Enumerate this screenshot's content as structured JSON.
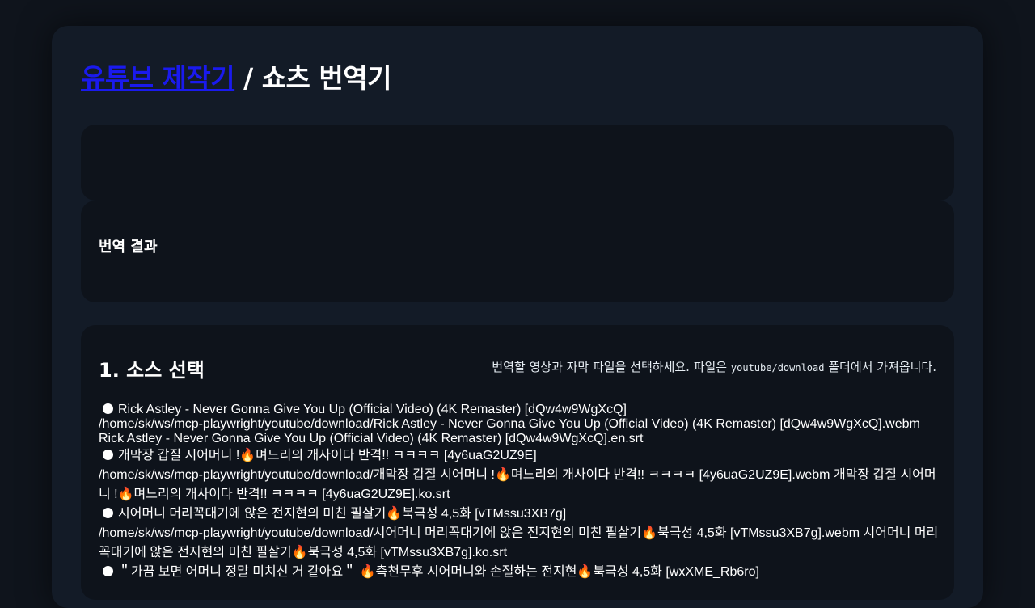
{
  "header": {
    "link_text": "유튜브 제작기",
    "separator": " / ",
    "page_title": "쇼츠 번역기"
  },
  "result": {
    "heading": "번역 결과"
  },
  "source": {
    "heading": "1. 소스 선택",
    "description_before": "번역할 영상과 자막 파일을 선택하세요. 파일은 ",
    "description_code": "youtube/download",
    "description_after": " 폴더에서 가져옵니다.",
    "items": [
      {
        "title": "Rick Astley - Never Gonna Give You Up (Official Video) (4K Remaster) [dQw4w9WgXcQ]",
        "video": "/home/sk/ws/mcp-playwright/youtube/download/Rick Astley - Never Gonna Give You Up (Official Video) (4K Remaster) [dQw4w9WgXcQ].webm",
        "subtitle": "Rick Astley - Never Gonna Give You Up (Official Video) (4K Remaster) [dQw4w9WgXcQ].en.srt"
      },
      {
        "title": "개막장 갑질 시어머니 !🔥며느리의 개사이다 반격!! ㅋㅋㅋㅋ [4y6uaG2UZ9E]",
        "video": "/home/sk/ws/mcp-playwright/youtube/download/개막장 갑질 시어머니 !🔥며느리의 개사이다 반격!! ㅋㅋㅋㅋ [4y6uaG2UZ9E].webm",
        "subtitle": "개막장 갑질 시어머니 !🔥며느리의 개사이다 반격!! ㅋㅋㅋㅋ [4y6uaG2UZ9E].ko.srt"
      },
      {
        "title": "시어머니 머리꼭대기에 앉은 전지현의 미친 필살기🔥북극성 4,5화 [vTMssu3XB7g]",
        "video": "/home/sk/ws/mcp-playwright/youtube/download/시어머니 머리꼭대기에 앉은 전지현의 미친 필살기🔥북극성 4,5화 [vTMssu3XB7g].webm",
        "subtitle": "시어머니 머리꼭대기에 앉은 전지현의 미친 필살기🔥북극성 4,5화 [vTMssu3XB7g].ko.srt"
      },
      {
        "title": "＂가끔 보면 어머니 정말 미치신 거 같아요＂ 🔥측천무후 시어머니와 손절하는 전지현🔥북극성 4,5화 [wxXME_Rb6ro]",
        "video": "",
        "subtitle": ""
      }
    ]
  }
}
